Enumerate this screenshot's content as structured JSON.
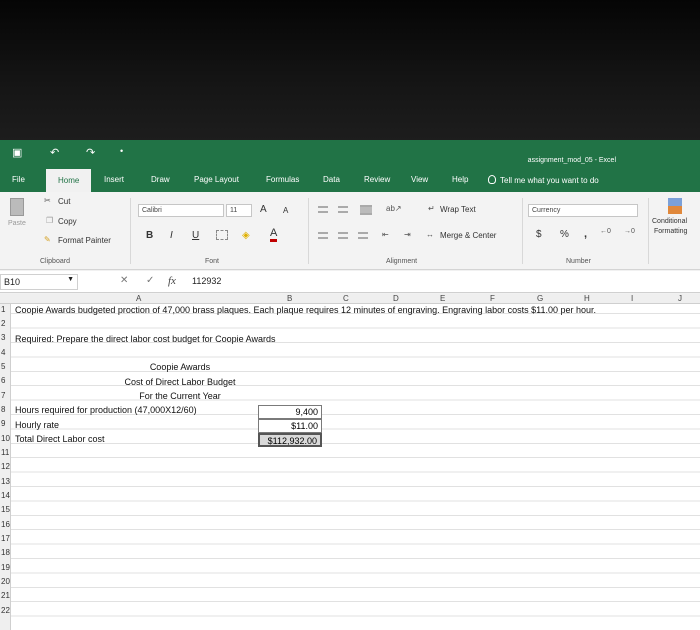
{
  "title_bar": {
    "document_title": "assignment_mod_05 - Excel"
  },
  "tabs": [
    "File",
    "Home",
    "Insert",
    "Draw",
    "Page Layout",
    "Formulas",
    "Data",
    "Review",
    "View",
    "Help"
  ],
  "tell_me": "Tell me what you want to do",
  "ribbon": {
    "paste": "Paste",
    "cut": "Cut",
    "copy": "Copy",
    "format_painter": "Format Painter",
    "clipboard": "Clipboard",
    "font_name": "Calibri",
    "font_size": "11",
    "grow_font": "A",
    "shrink_font": "A",
    "bold": "B",
    "italic": "I",
    "underline": "U",
    "font_color": "A",
    "font_group": "Font",
    "wrap_text": "Wrap Text",
    "merge_center": "Merge & Center",
    "alignment_group": "Alignment",
    "number_format": "Currency",
    "dollar": "$",
    "percent": "%",
    "comma": ",",
    "number_group": "Number",
    "conditional_formatting_1": "Conditional",
    "conditional_formatting_2": "Formatting"
  },
  "formula_bar": {
    "name_box": "B10",
    "fx": "fx",
    "value": "112932"
  },
  "columns": [
    "A",
    "B",
    "C",
    "D",
    "E",
    "F",
    "G",
    "H",
    "I",
    "J"
  ],
  "rows": [
    "1",
    "2",
    "3",
    "4",
    "5",
    "6",
    "7",
    "8",
    "9",
    "10",
    "11",
    "12",
    "13",
    "14",
    "15",
    "16",
    "17",
    "18",
    "19",
    "20",
    "21",
    "22"
  ],
  "cells": {
    "r1": "Coopie Awards budgeted proction of 47,000 brass plaques. Each plaque requires 12 minutes of engraving. Engraving labor costs $11.00 per hour.",
    "r3": "Required: Prepare the direct labor cost budget for Coopie Awards",
    "r5": "Coopie Awards",
    "r6": "Cost of Direct Labor Budget",
    "r7": "For the Current Year",
    "r8_label": "Hours required for production (47,000X12/60)",
    "r8_value": "9,400",
    "r9_label": "Hourly rate",
    "r9_value": "$11.00",
    "r10_label": "Total Direct Labor cost",
    "r10_value": "$112,932.00"
  }
}
